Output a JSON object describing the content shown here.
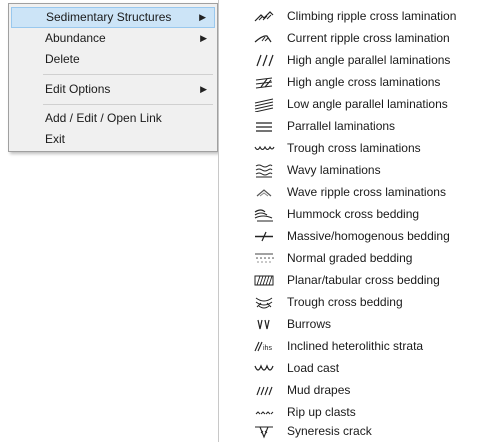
{
  "context_menu": {
    "items": [
      {
        "label": "Sedimentary Structures",
        "has_submenu": true,
        "highlighted": true
      },
      {
        "label": "Abundance",
        "has_submenu": true
      },
      {
        "label": "Delete",
        "has_submenu": false
      },
      {
        "label": "Edit Options",
        "has_submenu": true
      },
      {
        "label": "Add / Edit / Open Link",
        "has_submenu": false
      },
      {
        "label": "Exit",
        "has_submenu": false
      }
    ],
    "submenu_arrow": "▶"
  },
  "submenu": {
    "items": [
      {
        "label": "Climbing ripple cross lamination",
        "icon": "climbing-ripple-icon"
      },
      {
        "label": "Current ripple cross lamination",
        "icon": "current-ripple-icon"
      },
      {
        "label": "High angle parallel laminations",
        "icon": "high-angle-parallel-icon"
      },
      {
        "label": "High angle cross laminations",
        "icon": "high-angle-cross-icon"
      },
      {
        "label": "Low angle parallel laminations",
        "icon": "low-angle-parallel-icon"
      },
      {
        "label": "Parrallel laminations",
        "icon": "parallel-laminations-icon"
      },
      {
        "label": "Trough cross laminations",
        "icon": "trough-cross-lamination-icon"
      },
      {
        "label": "Wavy laminations",
        "icon": "wavy-laminations-icon"
      },
      {
        "label": "Wave ripple cross laminations",
        "icon": "wave-ripple-icon"
      },
      {
        "label": "Hummock cross bedding",
        "icon": "hummock-icon"
      },
      {
        "label": "Massive/homogenous bedding",
        "icon": "massive-bedding-icon"
      },
      {
        "label": "Normal graded bedding",
        "icon": "graded-bedding-icon"
      },
      {
        "label": "Planar/tabular cross bedding",
        "icon": "planar-tabular-icon"
      },
      {
        "label": "Trough cross bedding",
        "icon": "trough-cross-bedding-icon"
      },
      {
        "label": "Burrows",
        "icon": "burrows-icon"
      },
      {
        "label": "Inclined heterolithic strata",
        "icon": "ihs-icon"
      },
      {
        "label": "Load cast",
        "icon": "load-cast-icon"
      },
      {
        "label": "Mud drapes",
        "icon": "mud-drapes-icon"
      },
      {
        "label": "Rip up clasts",
        "icon": "rip-up-clasts-icon"
      },
      {
        "label": "Syneresis crack",
        "icon": "syneresis-crack-icon"
      }
    ],
    "ihs_icon_text": "ihs"
  },
  "colors": {
    "menu_bg": "#f0f0f0",
    "highlight_bg": "#cce4f7",
    "highlight_border": "#99c8ee",
    "icon_stroke": "#222222"
  }
}
